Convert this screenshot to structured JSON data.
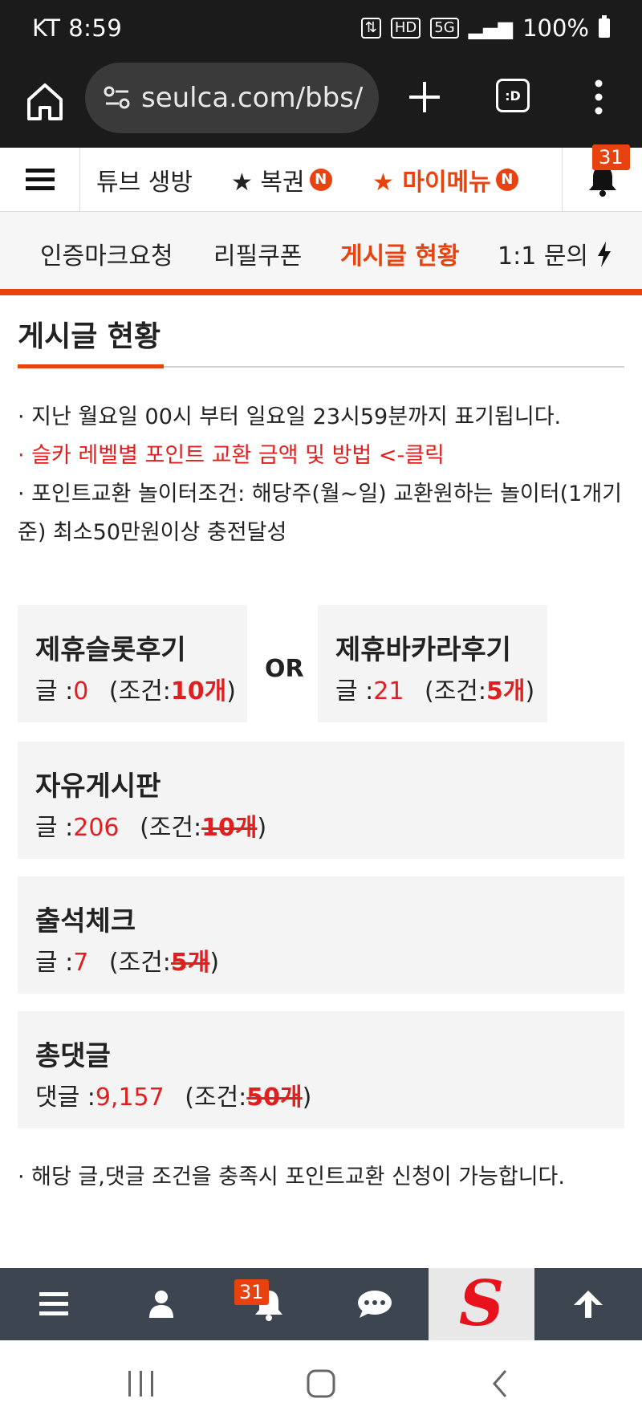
{
  "status": {
    "carrier_time": "KT 8:59",
    "battery": "100%",
    "hd": "HD",
    "net": "5G"
  },
  "browser": {
    "url": "seulca.com/bbs/",
    "tabs_label": ":D"
  },
  "topnav": {
    "items": [
      {
        "label": "튜브 생방"
      },
      {
        "label": "★ 복권",
        "badge": "N"
      },
      {
        "label": "★ 마이메뉴",
        "badge": "N"
      }
    ],
    "bell_count": "31"
  },
  "subnav": {
    "items": [
      "인증마크요청",
      "리필쿠폰",
      "게시글 현황",
      "1:1 문의"
    ]
  },
  "page": {
    "title": "게시글 현황",
    "notes": [
      "· 지난 월요일 00시 부터 일요일 23시59분까지 표기됩니다.",
      "· 슬카 레벨별 포인트 교환 금액 및 방법 <-클릭",
      "· 포인트교환 놀이터조건: 해당주(월~일) 교환원하는 놀이터(1개기준) 최소50만원이상 충전달성"
    ],
    "or_label": "OR",
    "footer_note": "· 해당 글,댓글 조건을 충족시 포인트교환 신청이 가능합니다."
  },
  "cards": [
    {
      "title": "제휴슬롯후기",
      "prefix": "글 :",
      "count": "0",
      "cond_open": "(조건:",
      "cond": "10개",
      "cond_close": ")"
    },
    {
      "title": "제휴바카라후기",
      "prefix": "글 :",
      "count": "21",
      "cond_open": "(조건:",
      "cond": "5개",
      "cond_close": ")"
    },
    {
      "title": "자유게시판",
      "prefix": "글 :",
      "count": "206",
      "cond_open": "(조건:",
      "cond": "10개",
      "cond_close": ")"
    },
    {
      "title": "출석체크",
      "prefix": "글 :",
      "count": "7",
      "cond_open": "(조건:",
      "cond": "5개",
      "cond_close": ")"
    },
    {
      "title": "총댓글",
      "prefix": "댓글 :",
      "count": "9,157",
      "cond_open": "(조건:",
      "cond": "50개",
      "cond_close": ")"
    }
  ],
  "bottomnav": {
    "bell_count": "31",
    "logo": "S"
  },
  "colors": {
    "accent": "#e8430f",
    "count_red": "#e02020",
    "dark": "#1b1b1b",
    "bottom_bar": "#3d4650"
  }
}
